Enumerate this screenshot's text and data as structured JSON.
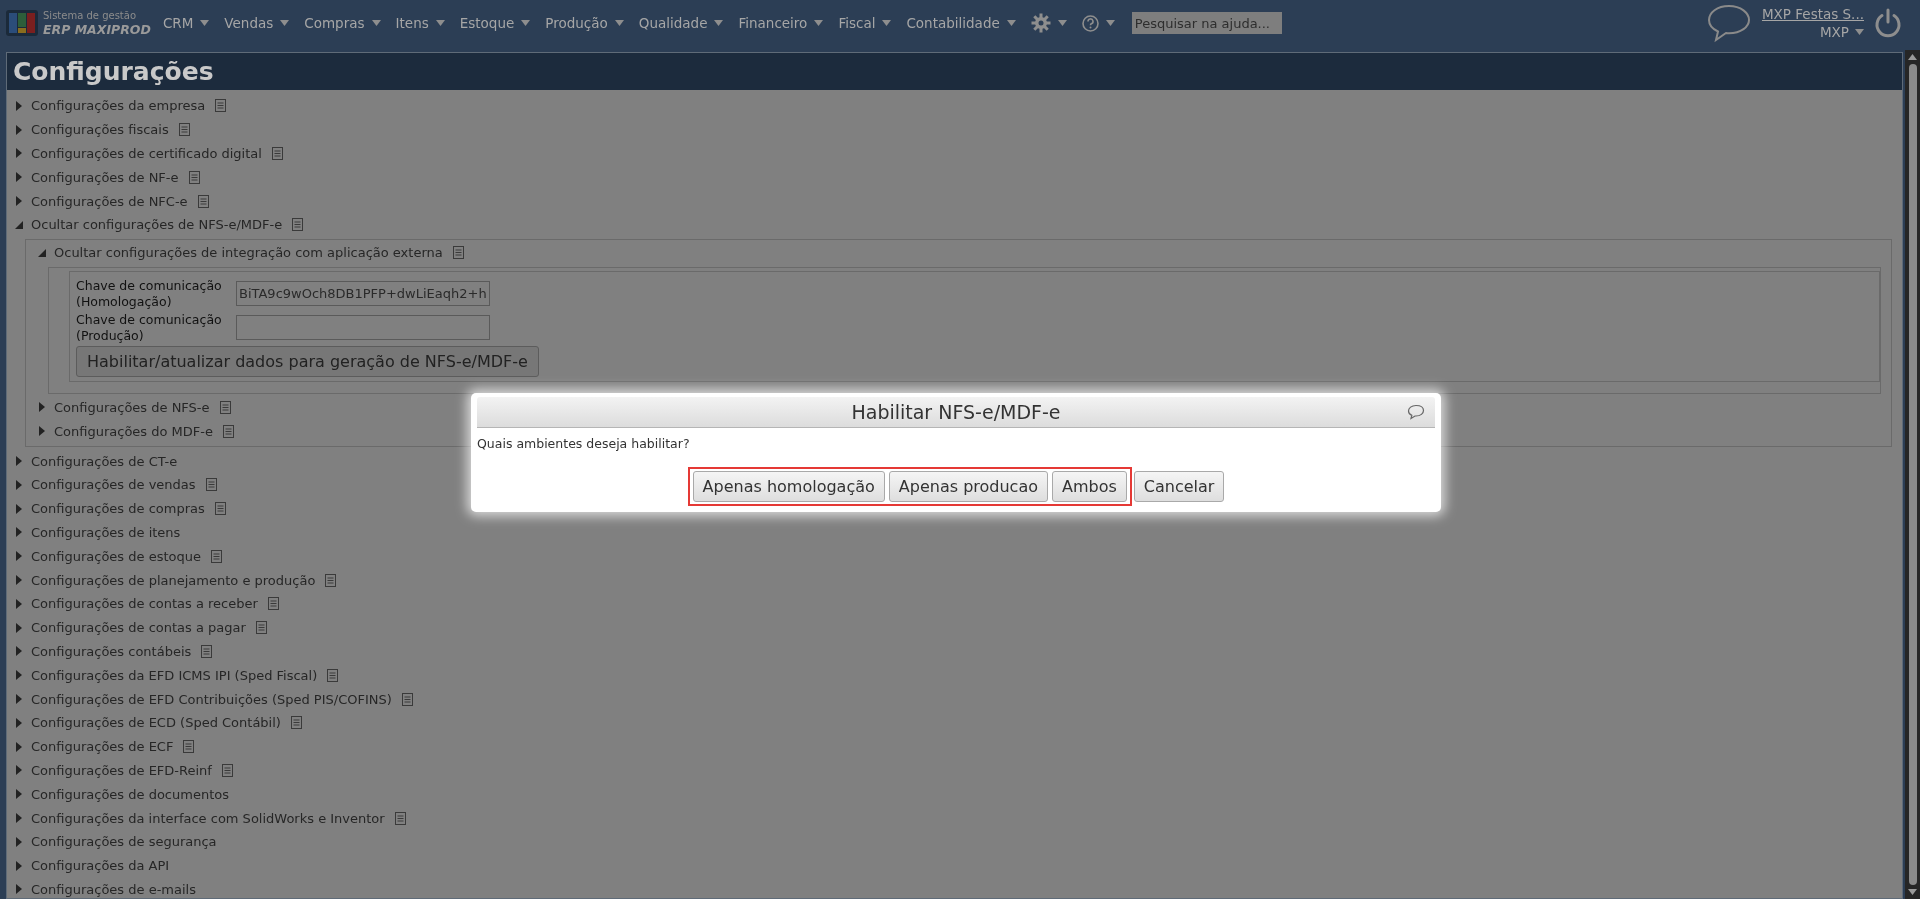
{
  "topbar": {
    "logo_caption": "Sistema de gestão",
    "logo_name": "ERP MAXIPROD",
    "menu": [
      {
        "label": "CRM"
      },
      {
        "label": "Vendas"
      },
      {
        "label": "Compras"
      },
      {
        "label": "Itens"
      },
      {
        "label": "Estoque"
      },
      {
        "label": "Produção"
      },
      {
        "label": "Qualidade"
      },
      {
        "label": "Financeiro"
      },
      {
        "label": "Fiscal"
      },
      {
        "label": "Contabilidade"
      }
    ],
    "search": {
      "placeholder": "Pesquisar na ajuda..."
    },
    "user_link": "MXP Festas S...",
    "company": "MXP"
  },
  "page": {
    "title": "Configurações"
  },
  "tree": [
    {
      "label": "Configurações da empresa",
      "expanded": false,
      "doc_icon": true
    },
    {
      "label": "Configurações fiscais",
      "expanded": false,
      "doc_icon": true
    },
    {
      "label": "Configurações de certificado digital",
      "expanded": false,
      "doc_icon": true
    },
    {
      "label": "Configurações de NF-e",
      "expanded": false,
      "doc_icon": true
    },
    {
      "label": "Configurações de NFC-e",
      "expanded": false,
      "doc_icon": true
    },
    {
      "label": "Ocultar configurações de NFS-e/MDF-e",
      "expanded": true,
      "doc_icon": true,
      "children": [
        {
          "label": "Ocultar configurações de integração com aplicação externa",
          "expanded": true,
          "doc_icon": true,
          "fields": [
            {
              "label": "Chave de comunicação (Homologação)",
              "value": "BiTA9c9wOch8DB1PFP+dwLiEaqh2+h"
            },
            {
              "label": "Chave de comunicação (Produção)"
            }
          ],
          "action_button": "Habilitar/atualizar dados para geração de NFS-e/MDF-e"
        },
        {
          "label": "Configurações de NFS-e",
          "expanded": false,
          "doc_icon": true
        },
        {
          "label": "Configurações do MDF-e",
          "expanded": false,
          "doc_icon": true
        }
      ]
    },
    {
      "label": "Configurações de CT-e",
      "expanded": false,
      "doc_icon": false
    },
    {
      "label": "Configurações de vendas",
      "expanded": false,
      "doc_icon": true
    },
    {
      "label": "Configurações de compras",
      "expanded": false,
      "doc_icon": true
    },
    {
      "label": "Configurações de itens",
      "expanded": false,
      "doc_icon": false
    },
    {
      "label": "Configurações de estoque",
      "expanded": false,
      "doc_icon": true
    },
    {
      "label": "Configurações de planejamento e produção",
      "expanded": false,
      "doc_icon": true
    },
    {
      "label": "Configurações de contas a receber",
      "expanded": false,
      "doc_icon": true
    },
    {
      "label": "Configurações de contas a pagar",
      "expanded": false,
      "doc_icon": true
    },
    {
      "label": "Configurações contábeis",
      "expanded": false,
      "doc_icon": true
    },
    {
      "label": "Configurações da EFD ICMS IPI (Sped Fiscal)",
      "expanded": false,
      "doc_icon": true
    },
    {
      "label": "Configurações de EFD Contribuições (Sped PIS/COFINS)",
      "expanded": false,
      "doc_icon": true
    },
    {
      "label": "Configurações de ECD (Sped Contábil)",
      "expanded": false,
      "doc_icon": true
    },
    {
      "label": "Configurações de ECF",
      "expanded": false,
      "doc_icon": true
    },
    {
      "label": "Configurações de EFD-Reinf",
      "expanded": false,
      "doc_icon": true
    },
    {
      "label": "Configurações de documentos",
      "expanded": false,
      "doc_icon": false
    },
    {
      "label": "Configurações da interface com SolidWorks e Inventor",
      "expanded": false,
      "doc_icon": true
    },
    {
      "label": "Configurações de segurança",
      "expanded": false,
      "doc_icon": false
    },
    {
      "label": "Configurações da API",
      "expanded": false,
      "doc_icon": false
    },
    {
      "label": "Configurações de e-mails",
      "expanded": false,
      "doc_icon": false
    }
  ],
  "dialog": {
    "title": "Habilitar NFS-e/MDF-e",
    "message": "Quais ambientes deseja habilitar?",
    "button_groups": [
      {
        "highlighted": true,
        "buttons": [
          "Apenas homologação",
          "Apenas producao",
          "Ambos"
        ]
      },
      {
        "highlighted": false,
        "buttons": [
          "Cancelar"
        ]
      }
    ]
  }
}
